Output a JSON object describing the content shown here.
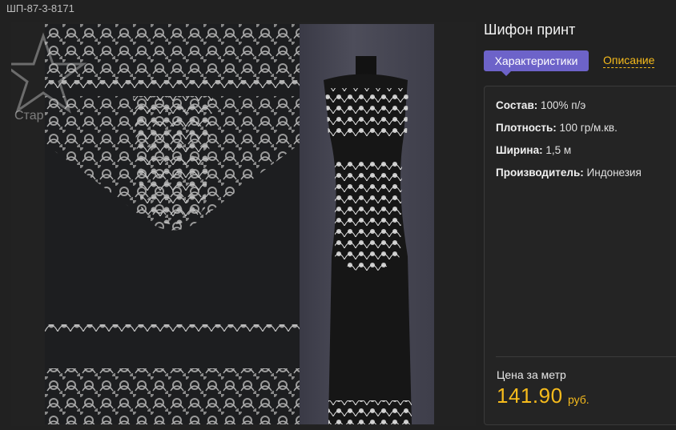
{
  "product": {
    "sku": "ШП-87-3-8171",
    "title": "Шифон принт",
    "watermark_text": "Стар"
  },
  "tabs": [
    {
      "label": "Характеристики",
      "active": true
    },
    {
      "label": "Описание",
      "active": false
    }
  ],
  "specs": [
    {
      "key": "Состав:",
      "value": "100% п/э"
    },
    {
      "key": "Плотность:",
      "value": "100 гр/м.кв."
    },
    {
      "key": "Ширина:",
      "value": "1,5 м"
    },
    {
      "key": "Производитель:",
      "value": "Индонезия"
    }
  ],
  "price": {
    "label": "Цена за метр",
    "value": "141.90",
    "currency": "руб."
  },
  "colors": {
    "accent": "#6d63c9",
    "price": "#f6bb1c",
    "background": "#212121"
  }
}
